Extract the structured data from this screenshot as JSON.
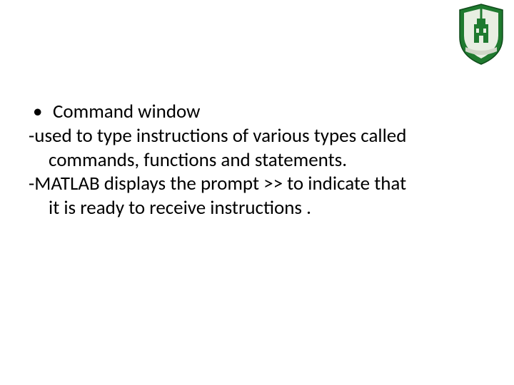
{
  "logo": {
    "name": "university-crest",
    "primary_color": "#1f7a2f",
    "accent_color": "#d0d6c8"
  },
  "content": {
    "bullet": {
      "mark": "•",
      "text": "Command window"
    },
    "dash1": {
      "mark": "-",
      "line1": "used to type instructions of various types called",
      "line2": "commands, functions and statements."
    },
    "dash2": {
      "mark": "-",
      "line1": "MATLAB displays the prompt >> to indicate that",
      "line2": "it is ready to receive instructions ."
    }
  }
}
